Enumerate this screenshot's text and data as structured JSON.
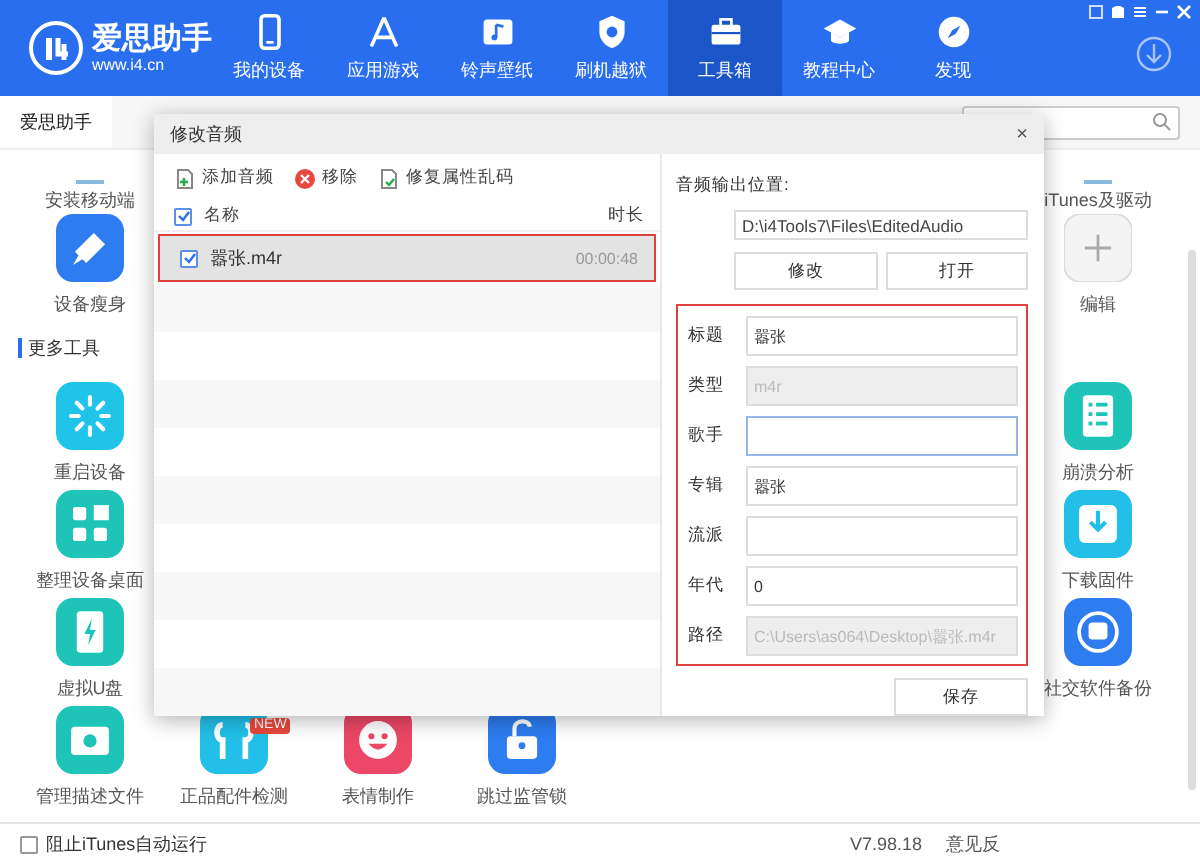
{
  "app": {
    "name": "爱思助手",
    "url": "www.i4.cn"
  },
  "nav": [
    {
      "label": "我的设备",
      "selected": false
    },
    {
      "label": "应用游戏",
      "selected": false
    },
    {
      "label": "铃声壁纸",
      "selected": false
    },
    {
      "label": "刷机越狱",
      "selected": false
    },
    {
      "label": "工具箱",
      "selected": true
    },
    {
      "label": "教程中心",
      "selected": false
    },
    {
      "label": "发现",
      "selected": false
    }
  ],
  "subtab": {
    "label": "爱思助手"
  },
  "tools_top": {
    "left": "安装移动端",
    "right": "iTunes及驱动"
  },
  "tools_first": {
    "left": [
      {
        "label": "设备瘦身"
      }
    ],
    "right": [
      {
        "label": "编辑"
      }
    ]
  },
  "section": "更多工具",
  "tool_rows": [
    {
      "left": [
        {
          "label": "重启设备"
        }
      ],
      "right": [
        {
          "label": "崩溃分析"
        }
      ]
    },
    {
      "left": [
        {
          "label": "整理设备桌面"
        }
      ],
      "right": [
        {
          "label": "下载固件"
        }
      ]
    },
    {
      "left": [
        {
          "label": "虚拟U盘"
        }
      ],
      "right": [
        {
          "label": "社交软件备份"
        }
      ]
    },
    {
      "left": [
        {
          "label": "管理描述文件"
        },
        {
          "label": "正品配件检测",
          "badge": "NEW"
        },
        {
          "label": "表情制作"
        },
        {
          "label": "跳过监管锁"
        }
      ],
      "right": []
    }
  ],
  "dialog": {
    "title": "修改音频",
    "close": "×",
    "toolbar": [
      "添加音频",
      "移除",
      "修复属性乱码"
    ],
    "columns": [
      "名称",
      "时长"
    ],
    "header_checked": true,
    "files": [
      {
        "name": "嚣张.m4r",
        "duration": "00:00:48",
        "checked": true,
        "selected": true
      }
    ],
    "output_label": "音频输出位置:",
    "output_path": "D:\\i4Tools7\\Files\\EditedAudio",
    "path_buttons": [
      "修改",
      "打开"
    ],
    "fields": [
      {
        "label": "标题",
        "value": "嚣张",
        "disabled": false,
        "focused": false
      },
      {
        "label": "类型",
        "value": "m4r",
        "disabled": true,
        "focused": false
      },
      {
        "label": "歌手",
        "disabled": false,
        "focused": true
      },
      {
        "label": "专辑",
        "value": "嚣张",
        "disabled": false,
        "focused": false
      },
      {
        "label": "流派",
        "disabled": false,
        "focused": false
      },
      {
        "label": "年代",
        "value": "0",
        "disabled": false,
        "focused": false
      },
      {
        "label": "路径",
        "value": "C:\\Users\\as064\\Desktop\\嚣张.m4r",
        "disabled": true,
        "focused": false
      }
    ],
    "save": "保存"
  },
  "status": {
    "block_itunes": {
      "label": "阻止iTunes自动运行",
      "checked": false
    },
    "version": "V7.98.18",
    "feedback": "意见反"
  }
}
